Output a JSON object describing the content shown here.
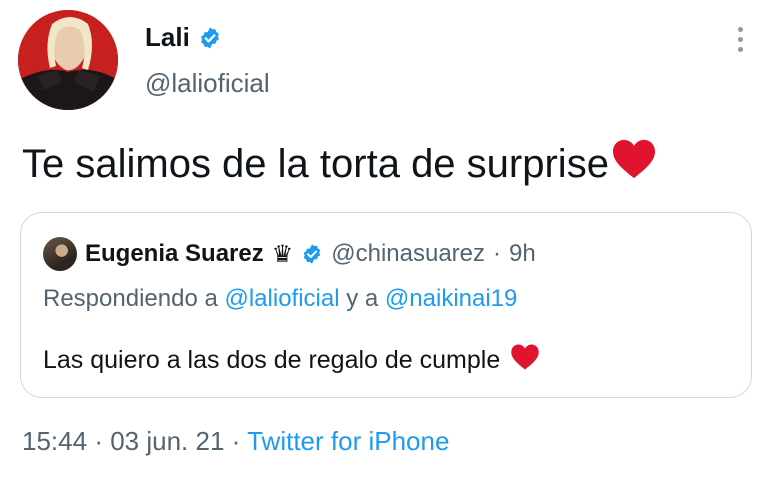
{
  "tweet": {
    "author": {
      "name": "Lali",
      "handle": "@lalioficial",
      "verified": true
    },
    "text": "Te salimos de la torta de surprise",
    "text_emoji": "heart-emoji",
    "more_icon": "more-vertical-icon",
    "quoted": {
      "author_name": "Eugenia Suarez",
      "crown": "♛",
      "handle": "@chinasuarez",
      "separator": "·",
      "time": "9h",
      "reply_prefix": "Respondiendo a",
      "reply_mention_1": "@lalioficial",
      "reply_connector": "y a",
      "reply_mention_2": "@naikinai19",
      "text": "Las quiero a las dos de regalo de cumple",
      "text_emoji": "heart-emoji"
    },
    "meta": {
      "time": "15:44",
      "sep1": "·",
      "date": "03 jun. 21",
      "sep2": "·",
      "source": "Twitter for iPhone"
    }
  },
  "colors": {
    "text_primary": "#0f1419",
    "text_secondary": "#536471",
    "link": "#1d9bf0",
    "border": "#cfd9de",
    "heart": "#e0142e"
  }
}
